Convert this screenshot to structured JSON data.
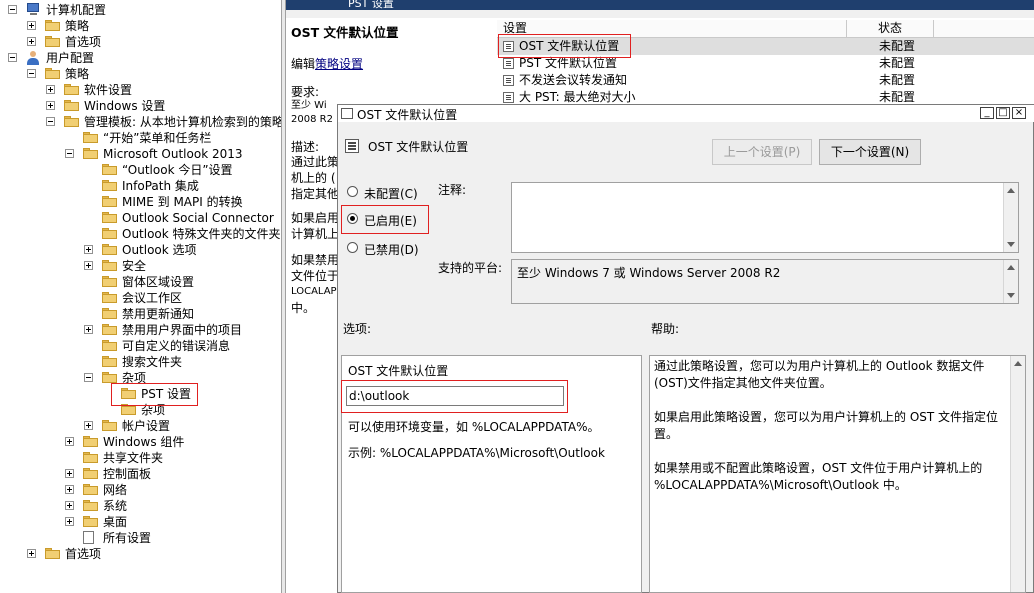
{
  "tree": {
    "nodes": [
      {
        "label": "计算机配置",
        "expander": "minus",
        "icon": "computer"
      },
      {
        "label": "策略",
        "expander": "plus",
        "icon": "folder"
      },
      {
        "label": "首选项",
        "expander": "plus",
        "icon": "folder"
      },
      {
        "label": "用户配置",
        "expander": "minus",
        "icon": "user"
      },
      {
        "label": "策略",
        "expander": "minus",
        "icon": "folder"
      },
      {
        "label": "软件设置",
        "expander": "plus",
        "icon": "folder"
      },
      {
        "label": "Windows 设置",
        "expander": "plus",
        "icon": "folder"
      },
      {
        "label": "管理模板: 从本地计算机检索到的策略",
        "expander": "minus",
        "icon": "folder"
      },
      {
        "label": "“开始”菜单和任务栏",
        "expander": "",
        "icon": "folder"
      },
      {
        "label": "Microsoft Outlook 2013",
        "expander": "minus",
        "icon": "folder"
      },
      {
        "label": "“Outlook 今日”设置",
        "expander": "",
        "icon": "folder"
      },
      {
        "label": "InfoPath 集成",
        "expander": "",
        "icon": "folder"
      },
      {
        "label": "MIME 到 MAPI 的转换",
        "expander": "",
        "icon": "folder"
      },
      {
        "label": "Outlook Social Connector",
        "expander": "",
        "icon": "folder"
      },
      {
        "label": "Outlook 特殊文件夹的文件夹主页",
        "expander": "",
        "icon": "folder"
      },
      {
        "label": "Outlook 选项",
        "expander": "plus",
        "icon": "folder"
      },
      {
        "label": "安全",
        "expander": "plus",
        "icon": "folder"
      },
      {
        "label": "窗体区域设置",
        "expander": "",
        "icon": "folder"
      },
      {
        "label": "会议工作区",
        "expander": "",
        "icon": "folder"
      },
      {
        "label": "禁用更新通知",
        "expander": "",
        "icon": "folder"
      },
      {
        "label": "禁用用户界面中的项目",
        "expander": "plus",
        "icon": "folder"
      },
      {
        "label": "可自定义的错误消息",
        "expander": "",
        "icon": "folder"
      },
      {
        "label": "搜索文件夹",
        "expander": "",
        "icon": "folder"
      },
      {
        "label": "杂项",
        "expander": "minus",
        "icon": "folder"
      },
      {
        "label": "PST 设置",
        "expander": "",
        "icon": "folder"
      },
      {
        "label": "杂项",
        "expander": "",
        "icon": "folder"
      },
      {
        "label": "帐户设置",
        "expander": "plus",
        "icon": "folder"
      },
      {
        "label": "Windows 组件",
        "expander": "plus",
        "icon": "folder"
      },
      {
        "label": "共享文件夹",
        "expander": "",
        "icon": "folder"
      },
      {
        "label": "控制面板",
        "expander": "plus",
        "icon": "folder"
      },
      {
        "label": "网络",
        "expander": "plus",
        "icon": "folder"
      },
      {
        "label": "系统",
        "expander": "plus",
        "icon": "folder"
      },
      {
        "label": "桌面",
        "expander": "plus",
        "icon": "folder"
      },
      {
        "label": "所有设置",
        "expander": "",
        "icon": "page"
      },
      {
        "label": "首选项",
        "expander": "plus",
        "icon": "folder"
      }
    ]
  },
  "window": {
    "header_title": "PST 设置"
  },
  "description": {
    "heading": "OST 文件默认位置",
    "edit_prefix": "编辑",
    "edit_link": "策略设置",
    "requirements_label": "要求:",
    "requirements_line1": "至少 Wi",
    "requirements_line2": "2008 R2",
    "desc_label": "描述:",
    "desc_lines": [
      "通过此策",
      "机上的 (",
      "指定其他"
    ],
    "enabled_lines": [
      "如果启用",
      "计算机上"
    ],
    "disabled_lines": [
      "如果禁用",
      "文件位于",
      "LOCALAP",
      "中。"
    ]
  },
  "list": {
    "col_setting": "设置",
    "col_state": "状态",
    "rows": [
      {
        "name": "OST 文件默认位置",
        "state": "未配置"
      },
      {
        "name": "PST 文件默认位置",
        "state": "未配置"
      },
      {
        "name": "不发送会议转发通知",
        "state": "未配置"
      },
      {
        "name": "大 PST: 最大绝对大小",
        "state": "未配置"
      }
    ]
  },
  "dialog": {
    "title": "OST 文件默认位置",
    "setting_name": "OST 文件默认位置",
    "prev_button": "上一个设置(P)",
    "next_button": "下一个设置(N)",
    "radio_not_configured": "未配置(C)",
    "radio_enabled": "已启用(E)",
    "radio_disabled": "已禁用(D)",
    "selected_radio": "enabled",
    "comment_label": "注释:",
    "comment_value": "",
    "platform_label": "支持的平台:",
    "platform_value": "至少 Windows 7 或 Windows Server 2008 R2",
    "options_label": "选项:",
    "help_label": "帮助:",
    "option_field_label": "OST 文件默认位置",
    "option_field_value": "d:\\outlook",
    "option_note": "可以使用环境变量，如 %LOCALAPPDATA%。",
    "option_example": "示例: %LOCALAPPDATA%\\Microsoft\\Outlook",
    "help_paragraphs": [
      "通过此策略设置，您可以为用户计算机上的 Outlook 数据文件(OST)文件指定其他文件夹位置。",
      "如果启用此策略设置，您可以为用户计算机上的 OST 文件指定位置。",
      "如果禁用或不配置此策略设置，OST 文件位于用户计算机上的 %LOCALAPPDATA%\\Microsoft\\Outlook 中。"
    ]
  },
  "colors": {
    "highlight_box": "#e02020",
    "title_bar": "#1f3f6e"
  }
}
